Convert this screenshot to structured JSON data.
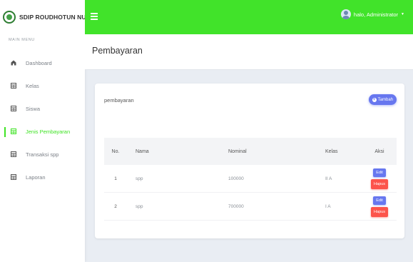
{
  "brand": {
    "name": "SDIP ROUDHOTUN NUR"
  },
  "sidebar": {
    "menu_label": "MAIN MENU",
    "items": [
      {
        "label": "Dashboard",
        "icon": "dashboard-icon",
        "active": false
      },
      {
        "label": "Kelas",
        "icon": "table-icon",
        "active": false
      },
      {
        "label": "Siswa",
        "icon": "table-icon",
        "active": false
      },
      {
        "label": "Jenis Pembayaran",
        "icon": "table-icon",
        "active": true
      },
      {
        "label": "Transaksi spp",
        "icon": "table-icon",
        "active": false
      },
      {
        "label": "Laporan",
        "icon": "table-icon",
        "active": false
      }
    ]
  },
  "topbar": {
    "user_greeting": "halo, Administrator",
    "caret": "▼"
  },
  "page": {
    "title": "Pembayaran"
  },
  "card": {
    "title": "pembayaran",
    "add_button": {
      "plus": "+",
      "label": "Tambah"
    },
    "table": {
      "headers": [
        "No.",
        "Nama",
        "Nominal",
        "Kelas",
        "Aksi"
      ],
      "rows": [
        {
          "no": "1",
          "nama": "spp",
          "nominal": "100000",
          "kelas": "II A"
        },
        {
          "no": "2",
          "nama": "spp",
          "nominal": "700000",
          "kelas": "I A"
        }
      ],
      "edit_label": "Edit",
      "delete_label": "Hapus"
    }
  },
  "colors": {
    "accent_green": "#41e32a",
    "primary": "#6777ef",
    "danger": "#fc544b"
  }
}
